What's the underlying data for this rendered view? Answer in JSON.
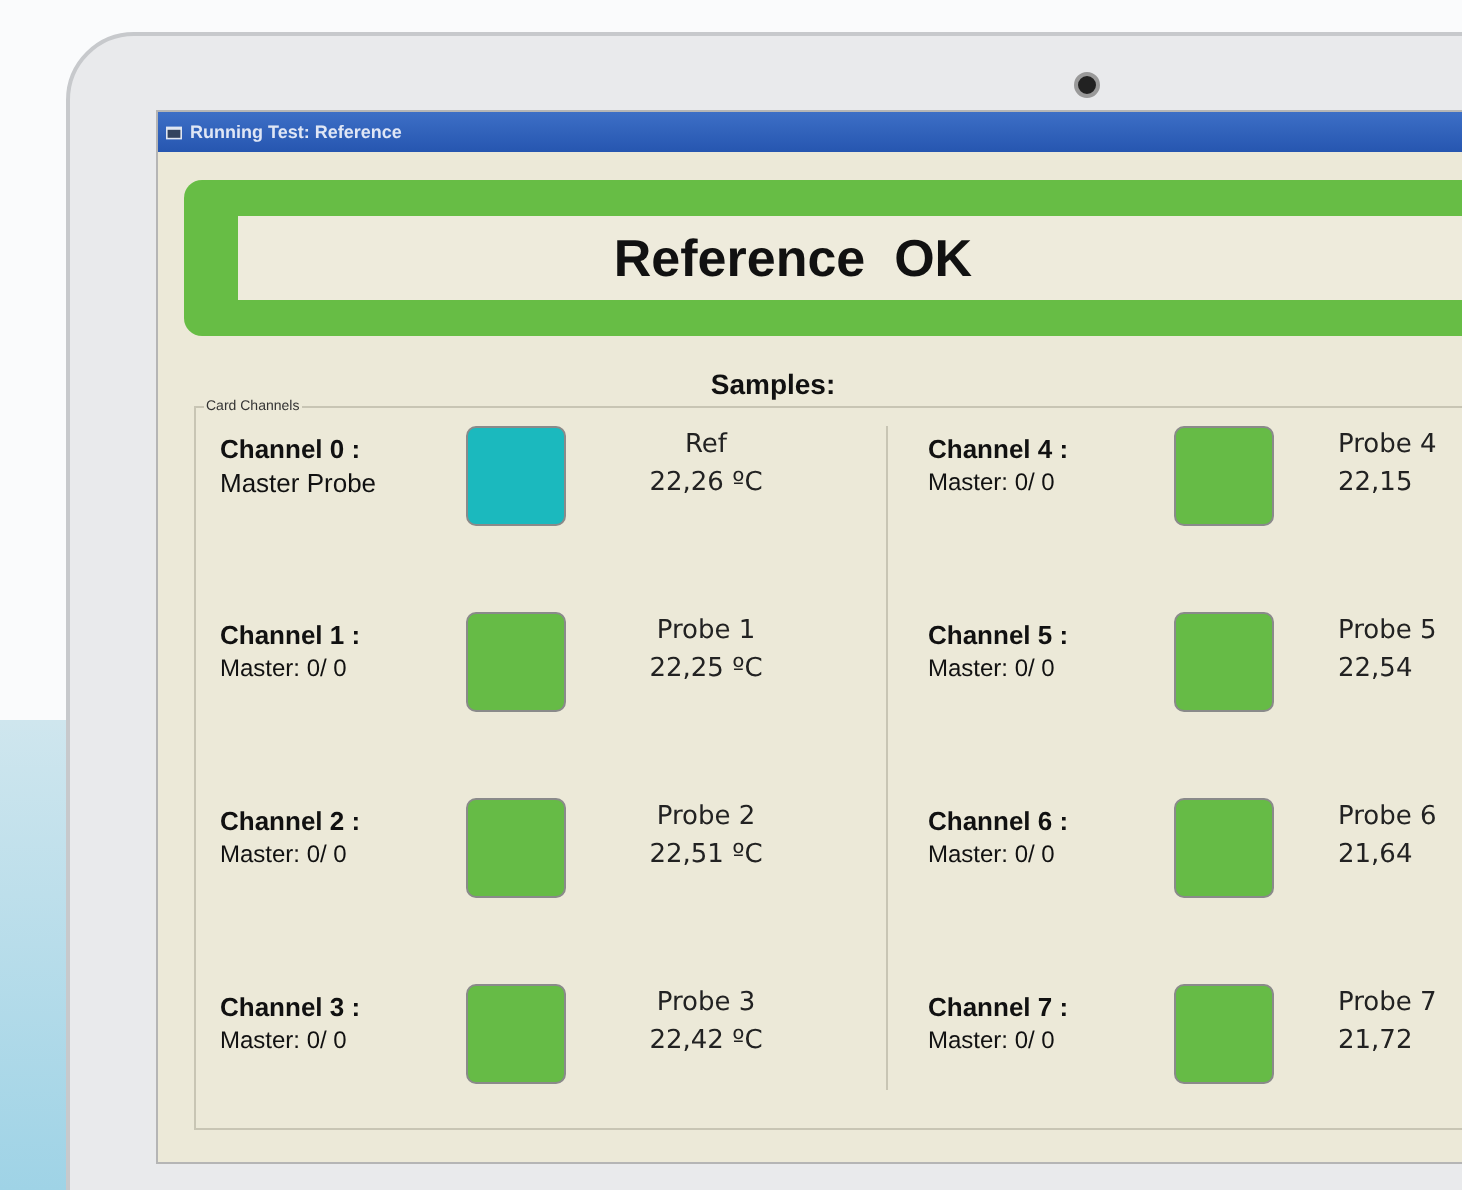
{
  "window": {
    "title": "Running Test: Reference"
  },
  "status_banner": {
    "text": "Reference  OK"
  },
  "samples_label": "Samples:",
  "group": {
    "label": "Card Channels"
  },
  "channels": [
    {
      "name": "Channel 0 :",
      "detail": "Master Probe",
      "color": "#1bb9be",
      "probe": "Ref",
      "reading": "22,26 ºC"
    },
    {
      "name": "Channel 1 :",
      "detail": "Master: 0/ 0",
      "color": "#66bb46",
      "probe": "Probe 1",
      "reading": "22,25 ºC"
    },
    {
      "name": "Channel 2 :",
      "detail": "Master: 0/ 0",
      "color": "#66bb46",
      "probe": "Probe 2",
      "reading": "22,51 ºC"
    },
    {
      "name": "Channel 3 :",
      "detail": "Master: 0/ 0",
      "color": "#66bb46",
      "probe": "Probe 3",
      "reading": "22,42 ºC"
    },
    {
      "name": "Channel 4 :",
      "detail": "Master: 0/ 0",
      "color": "#66bb46",
      "probe": "Probe 4",
      "reading": "22,15"
    },
    {
      "name": "Channel 5 :",
      "detail": "Master: 0/ 0",
      "color": "#66bb46",
      "probe": "Probe 5",
      "reading": "22,54"
    },
    {
      "name": "Channel 6 :",
      "detail": "Master: 0/ 0",
      "color": "#66bb46",
      "probe": "Probe 6",
      "reading": "21,64"
    },
    {
      "name": "Channel 7 :",
      "detail": "Master: 0/ 0",
      "color": "#66bb46",
      "probe": "Probe 7",
      "reading": "21,72"
    }
  ]
}
